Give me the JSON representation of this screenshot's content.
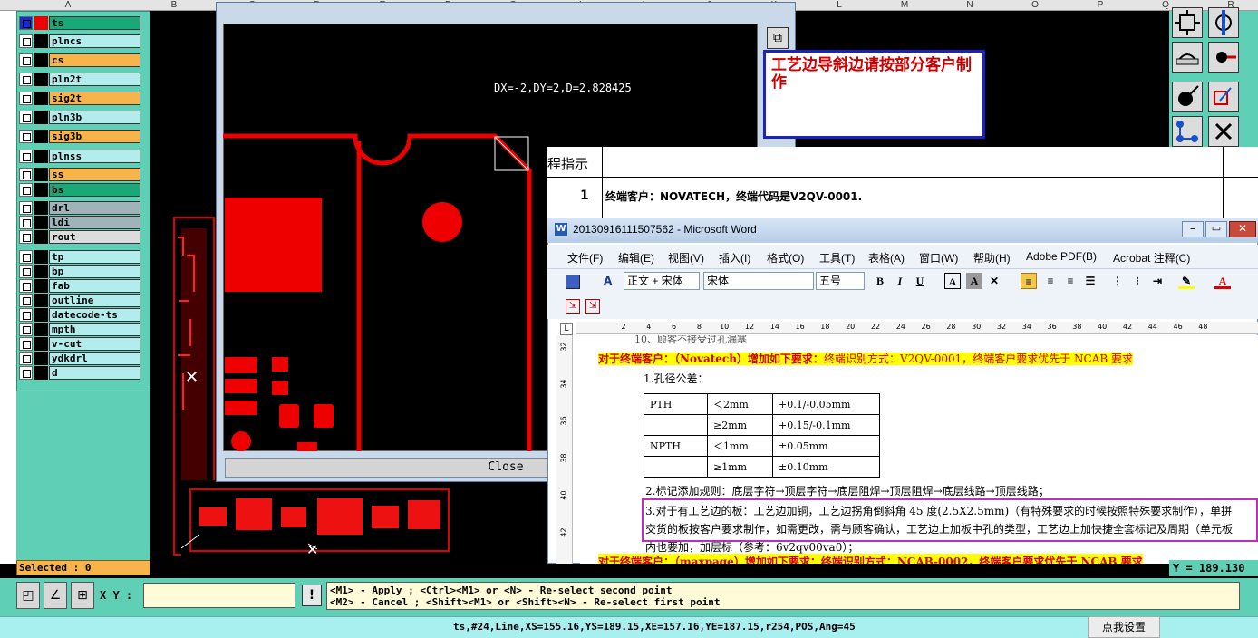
{
  "columns": [
    "A",
    "B",
    "C",
    "D",
    "E",
    "F",
    "G",
    "H",
    "I",
    "J",
    "K",
    "L",
    "M",
    "N",
    "O",
    "P",
    "Q",
    "R"
  ],
  "layers": [
    {
      "name": "ts",
      "color": "#19a878"
    },
    {
      "name": "plncs",
      "color": "#b3ecec"
    },
    {
      "name": "cs",
      "color": "#f6b44b"
    },
    {
      "name": "pln2t",
      "color": "#b3ecec"
    },
    {
      "name": "sig2t",
      "color": "#f6b44b"
    },
    {
      "name": "pln3b",
      "color": "#b3ecec"
    },
    {
      "name": "sig3b",
      "color": "#f6b44b"
    },
    {
      "name": "plnss",
      "color": "#b3ecec"
    },
    {
      "name": "ss",
      "color": "#f6b44b"
    },
    {
      "name": "bs",
      "color": "#19a878"
    },
    {
      "name": "drl",
      "color": "#9fb3b8"
    },
    {
      "name": "ldi",
      "color": "#9fb3b8"
    },
    {
      "name": "rout",
      "color": "#dcdcdc"
    },
    {
      "name": "tp",
      "color": "#b3ecec"
    },
    {
      "name": "bp",
      "color": "#b3ecec"
    },
    {
      "name": "fab",
      "color": "#b3ecec"
    },
    {
      "name": "outline",
      "color": "#b3ecec"
    },
    {
      "name": "datecode-ts",
      "color": "#b3ecec"
    },
    {
      "name": "mpth",
      "color": "#b3ecec"
    },
    {
      "name": "v-cut",
      "color": "#b3ecec"
    },
    {
      "name": "ydkdrl",
      "color": "#b3ecec"
    },
    {
      "name": "d",
      "color": "#b3ecec"
    }
  ],
  "selected": "Selected : 0",
  "options_window": {
    "measure": "DX=-2,DY=2,D=2.828425",
    "close_label": "Close"
  },
  "note": "工艺边导斜边请按部分客户制作",
  "doc_behind": {
    "header_fragment": "程指示",
    "row_num": "1",
    "row_text": "终端客户：NOVATECH，终端代码是V2QV-0001."
  },
  "word": {
    "title": "20130916111507562 - Microsoft Word",
    "menu": [
      "文件(F)",
      "编辑(E)",
      "视图(V)",
      "插入(I)",
      "格式(O)",
      "工具(T)",
      "表格(A)",
      "窗口(W)",
      "帮助(H)",
      "Adobe PDF(B)",
      "Acrobat 注释(C)"
    ],
    "style_combo": "正文 + 宋体",
    "font_combo": "宋体",
    "size_combo": "五号",
    "ruler_ticks": [
      "2",
      "4",
      "6",
      "8",
      "10",
      "12",
      "14",
      "16",
      "18",
      "20",
      "22",
      "24",
      "26",
      "28",
      "30",
      "32",
      "34",
      "36",
      "38",
      "40",
      "42",
      "44",
      "46",
      "48"
    ],
    "vruler_ticks": [
      "32",
      "34",
      "36",
      "38",
      "40",
      "42"
    ],
    "top_cut": "10、顾客不接受过孔漏塞",
    "req_label": "对于终端客户：（Novatech）增加如下要求：",
    "req_text": "终端识别方式：V2QV-0001，终端客户要求优先于 NCAB 要求",
    "item1": "1.孔径公差：",
    "table": [
      [
        "PTH",
        "＜2mm",
        "+0.1/-0.05mm"
      ],
      [
        "",
        "≥2mm",
        "+0.15/-0.1mm"
      ],
      [
        "NPTH",
        "＜1mm",
        "±0.05mm"
      ],
      [
        "",
        "≥1mm",
        "±0.10mm"
      ]
    ],
    "item2": "2.标记添加规则：底层字符→顶层字符→底层阻焊→顶层阻焊→底层线路→顶层线路；",
    "item3": "3.对于有工艺边的板：工艺边加铜，工艺边拐角倒斜角 45 度(2.5X2.5mm)（有特殊要求的时候按照特殊要求制作），单拼交货的板按客户要求制作，如需更改，需与顾客确认，工艺边上加板中孔的类型，工艺边上加快捷全套标记及周期（单元板内也要加，加层标（参考：6v2qv00va0）；",
    "bottom_cut": "对于终端客户：（maxpage）增加如下要求：终端识别方式：NCAB-0002，终端客户要求优先于 NCAB 要求"
  },
  "y_readout": "Y = 189.130",
  "xy_label": "X Y :",
  "hints": [
    "<M1> - Apply  ; <Ctrl><M1> or <N> - Re-select second point",
    "<M2> - Cancel ; <Shift><M1> or <Shift><N> - Re-select first point"
  ],
  "status": "ts,#24,Line,XS=155.16,YS=189.15,XE=157.16,YE=187.15,r254,POS,Ang=45",
  "click_settings": "点我设置"
}
